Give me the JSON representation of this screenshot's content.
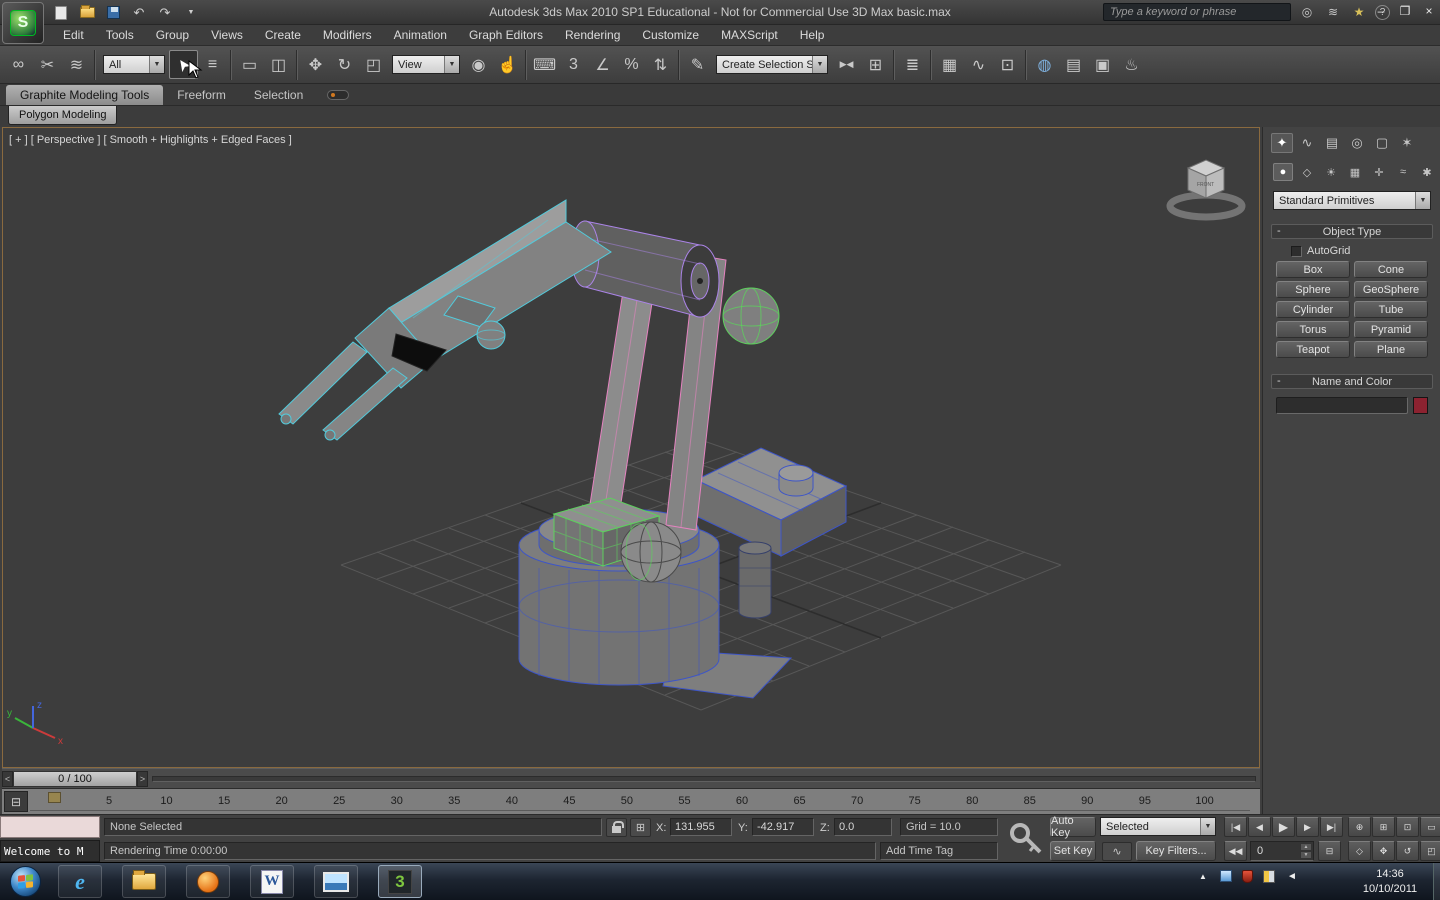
{
  "titlebar": {
    "title": "Autodesk 3ds Max 2010 SP1   Educational - Not for Commercial Use   3D Max basic.max",
    "search_placeholder": "Type a keyword or phrase"
  },
  "menubar": {
    "items": [
      "Edit",
      "Tools",
      "Group",
      "Views",
      "Create",
      "Modifiers",
      "Animation",
      "Graph Editors",
      "Rendering",
      "Customize",
      "MAXScript",
      "Help"
    ]
  },
  "toolbar": {
    "filter_value": "All",
    "coord_value": "View",
    "selection_set_value": "Create Selection Se"
  },
  "ribbon": {
    "tabs": [
      "Graphite Modeling Tools",
      "Freeform",
      "Selection"
    ],
    "modeling_tab": "Polygon Modeling"
  },
  "viewport": {
    "label": "[ + ] [ Perspective ] [ Smooth + Highlights + Edged Faces ]",
    "axis": {
      "x": "x",
      "y": "y",
      "z": "z"
    },
    "viewcube_front": "FRONT"
  },
  "command_panel": {
    "dropdown_value": "Standard Primitives",
    "object_type": {
      "title": "Object Type",
      "collapse": "-",
      "autogrid_label": "AutoGrid",
      "buttons": [
        "Box",
        "Cone",
        "Sphere",
        "GeoSphere",
        "Cylinder",
        "Tube",
        "Torus",
        "Pyramid",
        "Teapot",
        "Plane"
      ]
    },
    "name_color": {
      "title": "Name and Color",
      "collapse": "-"
    }
  },
  "timeline": {
    "slider_label": "0 / 100",
    "prev": "<",
    "next": ">",
    "ticks": [
      "5",
      "10",
      "15",
      "20",
      "25",
      "30",
      "35",
      "40",
      "45",
      "50",
      "55",
      "60",
      "65",
      "70",
      "75",
      "80",
      "85",
      "90",
      "95",
      "100"
    ]
  },
  "status": {
    "listener_text": "Welcome to M",
    "selection_status": "None Selected",
    "x_label": "X:",
    "x_value": "131.955",
    "y_label": "Y:",
    "y_value": "-42.917",
    "z_label": "Z:",
    "z_value": "0.0",
    "grid_status": "Grid = 10.0",
    "rendering_status": "Rendering Time  0:00:00",
    "time_tag": "Add Time Tag",
    "auto_key": "Auto Key",
    "set_key": "Set Key",
    "key_mode": "Selected",
    "key_filters": "Key Filters...",
    "frame_value": "0"
  },
  "taskbar": {
    "time": "14:36",
    "date": "10/10/2011"
  },
  "icons": {
    "logo": "S",
    "undo": "↶",
    "redo": "↷",
    "link": "∞",
    "unlink": "✂",
    "bind": "≋",
    "select": "➤",
    "by_name": "≡",
    "region": "▭",
    "crossing": "◫",
    "move": "✥",
    "rotate": "↻",
    "scale": "◰",
    "pivot": "◉",
    "manipulate": "☝",
    "keyboard": "⌨",
    "snap": "3",
    "angle": "∠",
    "percent": "%",
    "spinner": "⇅",
    "named_sel": "✎",
    "mirror": "▶◀",
    "align": "⊞",
    "layers": "≣",
    "ribbon_toggle": "▦",
    "curve": "∿",
    "schematic": "⊡",
    "material": "◍",
    "render_setup": "▤",
    "render_frame": "▣",
    "render": "♨",
    "tab_create": "✦",
    "tab_modify": "∿",
    "tab_hierarchy": "▤",
    "tab_motion": "◎",
    "tab_display": "▢",
    "tab_utilities": "✶",
    "cat_geometry": "●",
    "cat_shapes": "◇",
    "cat_lights": "☀",
    "cat_cameras": "▦",
    "cat_helpers": "✛",
    "cat_spacewarps": "≈",
    "cat_systems": "✱",
    "dd_arrow": "▼",
    "abs_offset": "⊞",
    "mini_curve": "⊟",
    "t_start": "|◀",
    "t_prev": "◀",
    "t_play": "▶",
    "t_next": "▶",
    "t_end": "▶|",
    "t_key": "◀◀",
    "nav_zoom": "⊕",
    "nav_zoom_all": "⊞",
    "nav_extents": "⊡",
    "nav_region": "▭",
    "nav_fov": "◇",
    "nav_pan": "✥",
    "nav_orbit": "↺",
    "nav_max": "◰",
    "win_min": "–",
    "win_max": "❐",
    "win_close": "×",
    "help": "?",
    "star": "★",
    "binoculars": "◎",
    "chevron_up": "▲",
    "volume": "◄"
  }
}
